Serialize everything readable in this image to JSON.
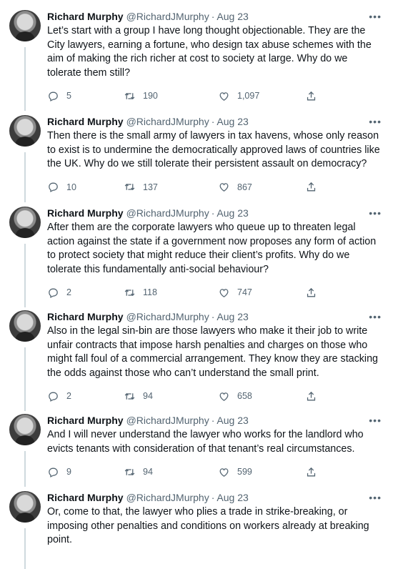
{
  "author": {
    "name": "Richard Murphy",
    "handle": "@RichardJMurphy",
    "date": "Aug 23"
  },
  "tweets": [
    {
      "text": "Let’s start with a group I have long thought objectionable. They are the City lawyers, earning a fortune, who design tax abuse schemes with the aim of making the rich richer at cost to society at large. Why do we tolerate them still?",
      "replies": "5",
      "retweets": "190",
      "likes": "1,097"
    },
    {
      "text": "Then there is the small army of lawyers in tax havens, whose only reason to exist is to undermine the democratically approved laws of countries like the UK. Why do we still tolerate their persistent assault on democracy?",
      "replies": "10",
      "retweets": "137",
      "likes": "867"
    },
    {
      "text": "After them are the corporate lawyers who queue up to threaten legal action against the state if a government now proposes any form of action to protect society that might reduce their client’s profits. Why do we tolerate this fundamentally anti-social behaviour?",
      "replies": "2",
      "retweets": "118",
      "likes": "747"
    },
    {
      "text": "Also in the legal sin-bin are those lawyers who make it their job to write unfair contracts that impose harsh penalties and charges on those who might fall foul of a commercial arrangement. They know they are stacking the odds against those who can’t understand the small print.",
      "replies": "2",
      "retweets": "94",
      "likes": "658"
    },
    {
      "text": "And I will never understand the lawyer who works for the landlord who evicts tenants with consideration of that tenant’s real circumstances.",
      "replies": "9",
      "retweets": "94",
      "likes": "599"
    },
    {
      "text": "Or, come to that, the lawyer who plies a trade in strike-breaking, or imposing other penalties and conditions on workers already at breaking point."
    }
  ],
  "icons": {
    "reply": "reply-icon",
    "retweet": "retweet-icon",
    "like": "heart-icon",
    "share": "share-icon",
    "more": "more-icon"
  },
  "colors": {
    "text": "#0f1419",
    "muted": "#536471",
    "thread_line": "#cfd9de"
  }
}
